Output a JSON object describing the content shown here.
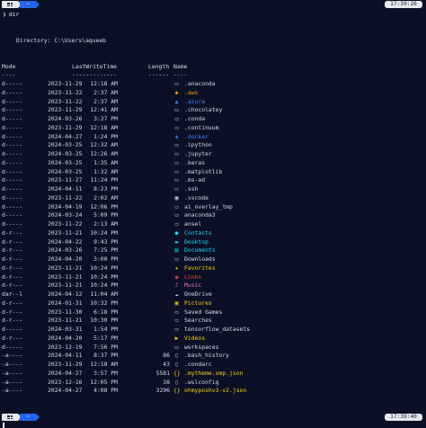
{
  "prompt": {
    "os_icon": "windows-icon",
    "path": "~",
    "time_top": "17:39:26",
    "time_bottom": "17:39:40",
    "chevron": "❯",
    "command": "dir"
  },
  "listing": {
    "directory_line": "Directory: C:\\Users\\aqueeb",
    "headers": {
      "mode": "Mode",
      "lastwritetime": "LastWriteTime",
      "length": "Length",
      "name": "Name"
    },
    "separators": {
      "mode": "----",
      "lastwritetime": "-------------",
      "length": "------",
      "name": "----"
    },
    "rows": [
      {
        "mode": "d-----",
        "date": "2023-11-29",
        "time": "12:18 AM",
        "length": "",
        "icon": "folder-icon",
        "glyph": "▭",
        "glyph_color": "#d7dae3",
        "name": ".anaconda",
        "color": "#d7dae3"
      },
      {
        "mode": "d-----",
        "date": "2023-11-22",
        "time": "2:37 AM",
        "length": "",
        "icon": "aws-icon",
        "glyph": "◆",
        "glyph_color": "#f59e0b",
        "name": ".aws",
        "color": "#f59e0b"
      },
      {
        "mode": "d-----",
        "date": "2023-11-22",
        "time": "2:37 AM",
        "length": "",
        "icon": "azure-icon",
        "glyph": "▲",
        "glyph_color": "#3b82f6",
        "name": ".azure",
        "color": "#3b82f6"
      },
      {
        "mode": "d-----",
        "date": "2023-11-29",
        "time": "12:41 AM",
        "length": "",
        "icon": "folder-icon",
        "glyph": "▭",
        "glyph_color": "#d7dae3",
        "name": ".chocolatey",
        "color": "#d7dae3"
      },
      {
        "mode": "d-----",
        "date": "2024-03-26",
        "time": "3:27 PM",
        "length": "",
        "icon": "folder-icon",
        "glyph": "▭",
        "glyph_color": "#d7dae3",
        "name": ".conda",
        "color": "#d7dae3"
      },
      {
        "mode": "d-----",
        "date": "2023-11-29",
        "time": "12:18 AM",
        "length": "",
        "icon": "folder-icon",
        "glyph": "▭",
        "glyph_color": "#d7dae3",
        "name": ".continuum",
        "color": "#d7dae3"
      },
      {
        "mode": "d-----",
        "date": "2024-04-27",
        "time": "1:24 PM",
        "length": "",
        "icon": "docker-icon",
        "glyph": "◈",
        "glyph_color": "#3b82f6",
        "name": ".docker",
        "color": "#3b82f6"
      },
      {
        "mode": "d-----",
        "date": "2024-03-25",
        "time": "12:32 AM",
        "length": "",
        "icon": "folder-icon",
        "glyph": "▭",
        "glyph_color": "#d7dae3",
        "name": ".ipython",
        "color": "#d7dae3"
      },
      {
        "mode": "d-----",
        "date": "2024-03-25",
        "time": "12:26 AM",
        "length": "",
        "icon": "folder-icon",
        "glyph": "▭",
        "glyph_color": "#d7dae3",
        "name": ".jupyter",
        "color": "#d7dae3"
      },
      {
        "mode": "d-----",
        "date": "2024-03-25",
        "time": "1:35 AM",
        "length": "",
        "icon": "folder-icon",
        "glyph": "▭",
        "glyph_color": "#d7dae3",
        "name": ".keras",
        "color": "#d7dae3"
      },
      {
        "mode": "d-----",
        "date": "2024-03-25",
        "time": "1:32 AM",
        "length": "",
        "icon": "folder-icon",
        "glyph": "▭",
        "glyph_color": "#d7dae3",
        "name": ".matplotlib",
        "color": "#d7dae3"
      },
      {
        "mode": "d-----",
        "date": "2023-11-27",
        "time": "11:24 PM",
        "length": "",
        "icon": "folder-icon",
        "glyph": "▭",
        "glyph_color": "#d7dae3",
        "name": ".ms-ad",
        "color": "#d7dae3"
      },
      {
        "mode": "d-----",
        "date": "2024-04-11",
        "time": "8:23 PM",
        "length": "",
        "icon": "folder-icon",
        "glyph": "▭",
        "glyph_color": "#d7dae3",
        "name": ".ssh",
        "color": "#d7dae3"
      },
      {
        "mode": "d-----",
        "date": "2023-11-22",
        "time": "2:02 AM",
        "length": "",
        "icon": "vscode-folder-icon",
        "glyph": "▣",
        "glyph_color": "#d7dae3",
        "name": ".vscode",
        "color": "#d7dae3"
      },
      {
        "mode": "d-----",
        "date": "2024-04-19",
        "time": "12:06 PM",
        "length": "",
        "icon": "folder-icon",
        "glyph": "▭",
        "glyph_color": "#d7dae3",
        "name": "ai_overlay_tmp",
        "color": "#d7dae3"
      },
      {
        "mode": "d-----",
        "date": "2024-03-24",
        "time": "5:09 PM",
        "length": "",
        "icon": "folder-icon",
        "glyph": "▭",
        "glyph_color": "#d7dae3",
        "name": "anaconda3",
        "color": "#d7dae3"
      },
      {
        "mode": "d-----",
        "date": "2023-11-22",
        "time": "2:13 AM",
        "length": "",
        "icon": "folder-icon",
        "glyph": "▭",
        "glyph_color": "#d7dae3",
        "name": "ansel",
        "color": "#d7dae3"
      },
      {
        "mode": "d-r---",
        "date": "2023-11-21",
        "time": "10:24 PM",
        "length": "",
        "icon": "contacts-icon",
        "glyph": "●",
        "glyph_color": "#22d3ee",
        "name": "Contacts",
        "color": "#22d3ee"
      },
      {
        "mode": "d-r---",
        "date": "2024-04-22",
        "time": "9:43 PM",
        "length": "",
        "icon": "desktop-icon",
        "glyph": "▬",
        "glyph_color": "#22d3ee",
        "name": "Desktop",
        "color": "#22d3ee"
      },
      {
        "mode": "d-r---",
        "date": "2024-03-26",
        "time": "7:25 PM",
        "length": "",
        "icon": "documents-icon",
        "glyph": "▤",
        "glyph_color": "#22d3ee",
        "name": "Documents",
        "color": "#22d3ee"
      },
      {
        "mode": "d-r---",
        "date": "2024-04-20",
        "time": "3:00 PM",
        "length": "",
        "icon": "downloads-icon",
        "glyph": "▭",
        "glyph_color": "#d7dae3",
        "name": "Downloads",
        "color": "#d7dae3"
      },
      {
        "mode": "d-r---",
        "date": "2023-11-21",
        "time": "10:24 PM",
        "length": "",
        "icon": "favorites-icon",
        "glyph": "★",
        "glyph_color": "#facc15",
        "name": "Favorites",
        "color": "#facc15"
      },
      {
        "mode": "d-r---",
        "date": "2023-11-21",
        "time": "10:24 PM",
        "length": "",
        "icon": "links-icon",
        "glyph": "◉",
        "glyph_color": "#ef4444",
        "name": "Links",
        "color": "#ef4444"
      },
      {
        "mode": "d-r---",
        "date": "2023-11-21",
        "time": "10:24 PM",
        "length": "",
        "icon": "music-icon",
        "glyph": "♪",
        "glyph_color": "#f472b6",
        "name": "Music",
        "color": "#f472b6"
      },
      {
        "mode": "dar--l",
        "date": "2024-04-12",
        "time": "11:04 AM",
        "length": "",
        "icon": "onedrive-icon",
        "glyph": "☁",
        "glyph_color": "#d7dae3",
        "name": "OneDrive",
        "color": "#d7dae3"
      },
      {
        "mode": "d-r---",
        "date": "2024-01-31",
        "time": "10:32 PM",
        "length": "",
        "icon": "pictures-icon",
        "glyph": "▣",
        "glyph_color": "#facc15",
        "name": "Pictures",
        "color": "#facc15"
      },
      {
        "mode": "d-r---",
        "date": "2023-11-30",
        "time": "6:18 PM",
        "length": "",
        "icon": "saved-games-icon",
        "glyph": "▭",
        "glyph_color": "#d7dae3",
        "name": "Saved Games",
        "color": "#d7dae3"
      },
      {
        "mode": "d-r---",
        "date": "2023-11-21",
        "time": "10:30 PM",
        "length": "",
        "icon": "searches-icon",
        "glyph": "▭",
        "glyph_color": "#d7dae3",
        "name": "Searches",
        "color": "#d7dae3"
      },
      {
        "mode": "d-----",
        "date": "2024-03-31",
        "time": "1:54 PM",
        "length": "",
        "icon": "folder-icon",
        "glyph": "▭",
        "glyph_color": "#d7dae3",
        "name": "tensorflow_datasets",
        "color": "#d7dae3"
      },
      {
        "mode": "d-r---",
        "date": "2024-04-20",
        "time": "5:17 PM",
        "length": "",
        "icon": "videos-icon",
        "glyph": "▶",
        "glyph_color": "#facc15",
        "name": "Videos",
        "color": "#facc15"
      },
      {
        "mode": "d-----",
        "date": "2023-12-19",
        "time": "7:56 PM",
        "length": "",
        "icon": "folder-icon",
        "glyph": "▭",
        "glyph_color": "#d7dae3",
        "name": "workspaces",
        "color": "#d7dae3"
      },
      {
        "mode": "-a----",
        "date": "2024-04-11",
        "time": "8:37 PM",
        "length": "86",
        "icon": "file-icon",
        "glyph": "▯",
        "glyph_color": "#d7dae3",
        "name": ".bash_history",
        "color": "#d7dae3"
      },
      {
        "mode": "-a----",
        "date": "2023-11-29",
        "time": "12:18 AM",
        "length": "43",
        "icon": "file-icon",
        "glyph": "▯",
        "glyph_color": "#d7dae3",
        "name": ".condarc",
        "color": "#d7dae3"
      },
      {
        "mode": "-a----",
        "date": "2024-04-27",
        "time": "3:57 PM",
        "length": "5581",
        "icon": "json-icon",
        "glyph": "{}",
        "glyph_color": "#facc15",
        "name": ".mytheme.omp.json",
        "color": "#facc15"
      },
      {
        "mode": "-a----",
        "date": "2023-12-16",
        "time": "12:05 PM",
        "length": "38",
        "icon": "file-icon",
        "glyph": "▯",
        "glyph_color": "#d7dae3",
        "name": ".wslconfig",
        "color": "#d7dae3"
      },
      {
        "mode": "-a----",
        "date": "2024-04-27",
        "time": "4:08 PM",
        "length": "3296",
        "icon": "json-icon",
        "glyph": "{}",
        "glyph_color": "#facc15",
        "name": "ohmyposhv3-v2.json",
        "color": "#facc15"
      }
    ]
  }
}
